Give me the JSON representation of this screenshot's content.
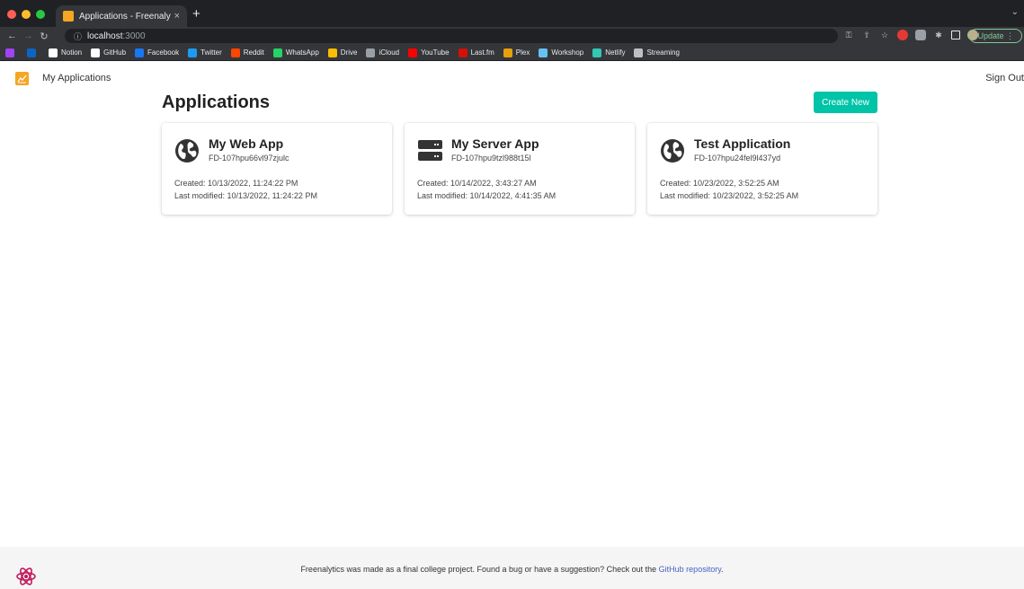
{
  "browser": {
    "tab_title": "Applications - Freenalytics",
    "tab_close": "×",
    "new_tab": "+",
    "url_host": "localhost",
    "url_port": ":3000",
    "update_label": "Update",
    "bookmarks": [
      {
        "label": "",
        "icon": "linkedin-icon",
        "color": "#0a66c2"
      },
      {
        "label": "Notion",
        "icon": "notion-icon",
        "color": "#ffffff"
      },
      {
        "label": "GitHub",
        "icon": "github-icon",
        "color": "#ffffff"
      },
      {
        "label": "Facebook",
        "icon": "facebook-icon",
        "color": "#1877f2"
      },
      {
        "label": "Twitter",
        "icon": "twitter-icon",
        "color": "#1d9bf0"
      },
      {
        "label": "Reddit",
        "icon": "reddit-icon",
        "color": "#ff4500"
      },
      {
        "label": "WhatsApp",
        "icon": "whatsapp-icon",
        "color": "#25d366"
      },
      {
        "label": "Drive",
        "icon": "drive-icon",
        "color": "#fbbc04"
      },
      {
        "label": "iCloud",
        "icon": "apple-icon",
        "color": "#9aa0a6"
      },
      {
        "label": "YouTube",
        "icon": "youtube-icon",
        "color": "#ff0000"
      },
      {
        "label": "Last.fm",
        "icon": "lastfm-icon",
        "color": "#d51007"
      },
      {
        "label": "Plex",
        "icon": "plex-icon",
        "color": "#e5a00d"
      },
      {
        "label": "Workshop",
        "icon": "workshop-icon",
        "color": "#66c0f4"
      },
      {
        "label": "Netlify",
        "icon": "netlify-icon",
        "color": "#32c6b4"
      },
      {
        "label": "Streaming",
        "icon": "folder-icon",
        "color": "#bdc1c6"
      }
    ]
  },
  "header": {
    "nav_label": "My Applications",
    "signout_label": "Sign Out",
    "brand_color": "#f5a623"
  },
  "main": {
    "title": "Applications",
    "create_label": "Create New",
    "accent_color": "#00c4a7",
    "apps": [
      {
        "name": "My Web App",
        "id": "FD-107hpu66vl97zjulc",
        "created": "Created: 10/13/2022, 11:24:22 PM",
        "modified": "Last modified: 10/13/2022, 11:24:22 PM",
        "icon": "globe-icon"
      },
      {
        "name": "My Server App",
        "id": "FD-107hpu9tzl988t15l",
        "created": "Created: 10/14/2022, 3:43:27 AM",
        "modified": "Last modified: 10/14/2022, 4:41:35 AM",
        "icon": "server-icon"
      },
      {
        "name": "Test Application",
        "id": "FD-107hpu24fel9l437yd",
        "created": "Created: 10/23/2022, 3:52:25 AM",
        "modified": "Last modified: 10/23/2022, 3:52:25 AM",
        "icon": "globe-icon"
      }
    ]
  },
  "footer": {
    "text": "Freenalytics was made as a final college project. Found a bug or have a suggestion? Check out the ",
    "link_label": "GitHub repository",
    "end": "."
  }
}
